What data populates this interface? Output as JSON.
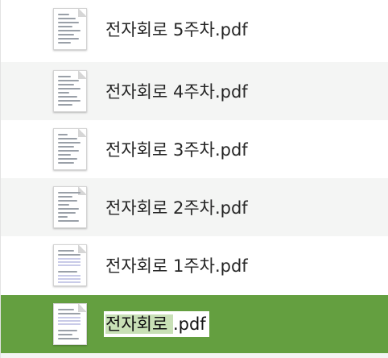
{
  "files": [
    {
      "name": "전자회로 5주차.pdf"
    },
    {
      "name": "전자회로 4주차.pdf"
    },
    {
      "name": "전자회로 3주차.pdf"
    },
    {
      "name": "전자회로 2주차.pdf"
    },
    {
      "name": "전자회로 1주차.pdf"
    }
  ],
  "rename": {
    "selected_text": "전자회로 ",
    "rest_text": ".pdf"
  },
  "colors": {
    "selection": "#649f40",
    "alt_row": "#f4f5f4",
    "text_highlight": "#c8e0b6"
  },
  "icons": {
    "file": "pdf-thumbnail-icon"
  }
}
